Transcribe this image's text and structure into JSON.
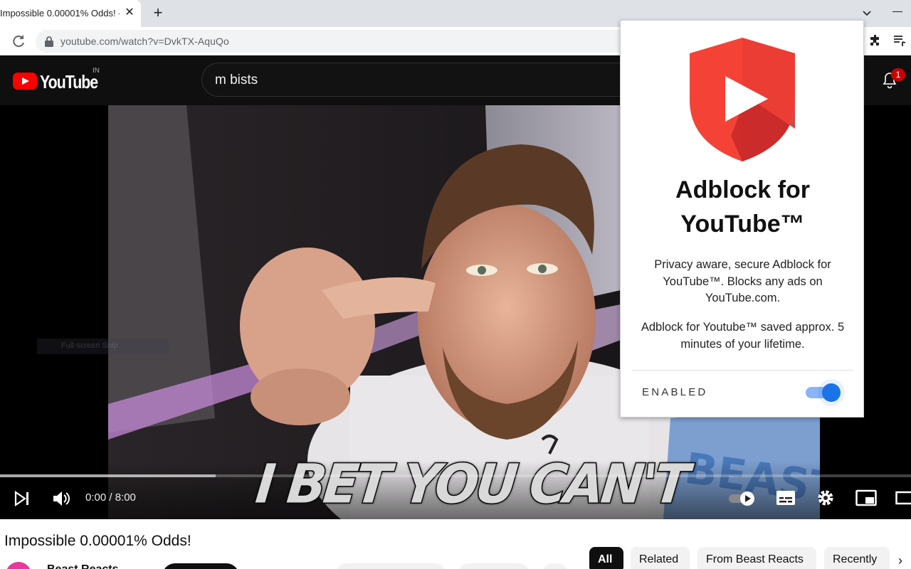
{
  "browser": {
    "tab_title": "Impossible 0.00001% Odds! -",
    "close_glyph": "✕",
    "new_tab_glyph": "+",
    "url": "youtube.com/watch?v=DvkTX-AquQo"
  },
  "youtube": {
    "wordmark": "YouTube",
    "country": "IN",
    "search_value": "m bists",
    "notification_count": "1",
    "snip_label": "Full-screen Snip",
    "caption": "I BET YOU CAN'T",
    "time": "0:00 / 8:00",
    "progress_buffered_fraction": 0.237,
    "video_title": "Impossible 0.00001% Odds!",
    "channel_name": "Beast Reacts",
    "chips": [
      "All",
      "Related",
      "From Beast Reacts",
      "Recently"
    ],
    "chip_next_glyph": "›"
  },
  "extension_popup": {
    "title": "Adblock for YouTube™",
    "description": "Privacy aware, secure Adblock for YouTube™. Blocks any ads on YouTube.com.",
    "saved_text": "Adblock for Youtube™ saved approx. 5 minutes of your lifetime.",
    "toggle_label": "ENABLED",
    "enabled": true
  },
  "colors": {
    "youtube_red": "#ff0000",
    "shield_red": "#f44336",
    "toggle_blue": "#1a73e8",
    "header_bg": "#0f0f0f"
  },
  "icons": [
    "close-icon",
    "plus-icon",
    "reload-icon",
    "lock-icon",
    "extensions-icon",
    "reading-list-icon",
    "bell-icon",
    "next-icon",
    "volume-icon",
    "autoplay-icon",
    "subtitles-icon",
    "settings-icon",
    "miniplayer-icon",
    "theater-icon",
    "shield-play-icon"
  ]
}
